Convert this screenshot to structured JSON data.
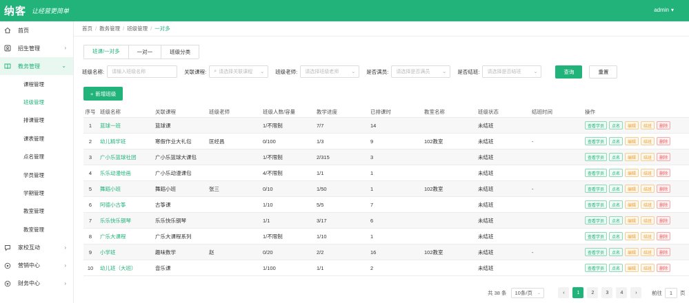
{
  "brand": {
    "logo": "纳客",
    "slogan": "让经营更简单"
  },
  "user": {
    "name": "admin"
  },
  "sidebar": {
    "items": [
      {
        "label": "首页",
        "icon": "home-icon"
      },
      {
        "label": "招生管理",
        "icon": "user-icon"
      },
      {
        "label": "教务管理",
        "icon": "book-icon"
      }
    ],
    "sub_items": [
      "课程管理",
      "班级管理",
      "排课管理",
      "课表管理",
      "点名管理",
      "学员管理",
      "学期管理",
      "教室管理",
      "教室管理"
    ],
    "bottom_items": [
      {
        "label": "家校互动",
        "icon": "chat-icon"
      },
      {
        "label": "营销中心",
        "icon": "gift-icon"
      },
      {
        "label": "财务中心",
        "icon": "money-icon"
      }
    ]
  },
  "breadcrumb": [
    "首页",
    "教务管理",
    "班级管理",
    "一对多"
  ],
  "tabs": [
    "班课/一对多",
    "一对一",
    "班级分类"
  ],
  "filters": {
    "class_name_label": "班级名称:",
    "class_name_placeholder": "请输入班级名称",
    "course_label": "关联课程:",
    "course_placeholder": "请选择关联课程",
    "teacher_label": "班级老师:",
    "teacher_placeholder": "请选择班级老师",
    "full_label": "是否满员:",
    "full_placeholder": "请选择是否满员",
    "end_label": "是否结班:",
    "end_placeholder": "请选择是否结班",
    "search": "查询",
    "reset": "重置"
  },
  "add_button": "新增班级",
  "table": {
    "headers": [
      "序号",
      "班级名称",
      "关联课程",
      "班级老师",
      "班级人数/容量",
      "教学进度",
      "已排课时",
      "教室名称",
      "班级状态",
      "结班时间",
      "操作"
    ],
    "rows": [
      [
        "1",
        "蓝球一班",
        "篮球课",
        "",
        "1/不限制",
        "7/7",
        "14",
        "",
        "未结班",
        ""
      ],
      [
        "2",
        "幼儿精学班",
        "寒假作业大礼包",
        "匡经昌",
        "0/100",
        "1/3",
        "9",
        "102教室",
        "未结班",
        "-"
      ],
      [
        "3",
        "广小乐篮球社团",
        "广小乐篮球大课包",
        "",
        "1/不限制",
        "2/315",
        "3",
        "",
        "未结班",
        ""
      ],
      [
        "4",
        "乐乐动漫绘画",
        "广小乐动漫课包",
        "",
        "4/不限制",
        "1/1",
        "1",
        "",
        "未结班",
        ""
      ],
      [
        "5",
        "舞蹈小班",
        "舞蹈小班",
        "张三",
        "0/10",
        "1/50",
        "1",
        "102教室",
        "未结班",
        "-"
      ],
      [
        "6",
        "阿德小古筝",
        "古筝课",
        "",
        "1/10",
        "5/5",
        "7",
        "",
        "未结班",
        ""
      ],
      [
        "7",
        "乐乐快乐钢琴",
        "乐乐快乐钢琴",
        "",
        "1/1",
        "3/17",
        "6",
        "",
        "未结班",
        ""
      ],
      [
        "8",
        "广乐大课程",
        "广乐大课程系列",
        "",
        "1/不限制",
        "1/10",
        "1",
        "",
        "未结班",
        ""
      ],
      [
        "9",
        "小学班",
        "趣味数学",
        "赵",
        "0/20",
        "2/2",
        "16",
        "102教室",
        "未结班",
        "-"
      ],
      [
        "10",
        "幼儿班（大班）",
        "音乐课",
        "",
        "1/100",
        "1/1",
        "2",
        "",
        "未结班",
        ""
      ]
    ],
    "ops": [
      "查看学员",
      "点名",
      "编辑",
      "结班",
      "删除"
    ]
  },
  "pagination": {
    "total": "共 38 条",
    "page_size": "10条/页",
    "prev": "‹",
    "pages": [
      "1",
      "2",
      "3",
      "4"
    ],
    "next": "›",
    "goto_label": "前往",
    "goto_value": "1",
    "goto_suffix": "页"
  },
  "colors": {
    "accent": "#22b37b"
  }
}
